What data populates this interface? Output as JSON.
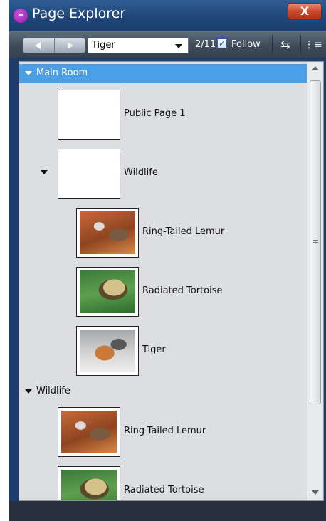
{
  "window": {
    "title": "Page Explorer",
    "close_label": "X"
  },
  "toolbar": {
    "selected_page": "Tiger",
    "page_count": "2/11",
    "follow_checked": true,
    "follow_label": "Follow",
    "swap_icon": "⇆",
    "menu_icon": "⋮≡"
  },
  "sections": [
    {
      "label": "Main Room",
      "selected": true,
      "nodes": [
        {
          "label": "Public Page 1",
          "thumb": "blank"
        },
        {
          "label": "Wildlife",
          "thumb": "blank",
          "expanded": true,
          "children": [
            {
              "label": "Ring-Tailed Lemur",
              "thumb": "lemur"
            },
            {
              "label": "Radiated Tortoise",
              "thumb": "tortoise"
            },
            {
              "label": "Tiger",
              "thumb": "tiger"
            }
          ]
        }
      ]
    },
    {
      "label": "Wildlife",
      "selected": false,
      "nodes": [
        {
          "label": "Ring-Tailed Lemur",
          "thumb": "lemur"
        },
        {
          "label": "Radiated Tortoise",
          "thumb": "tortoise"
        }
      ]
    }
  ],
  "colors": {
    "selection": "#4aa0e8",
    "titlebar": "#1f4577",
    "panel": "#dcdee1",
    "close": "#c8472a"
  }
}
